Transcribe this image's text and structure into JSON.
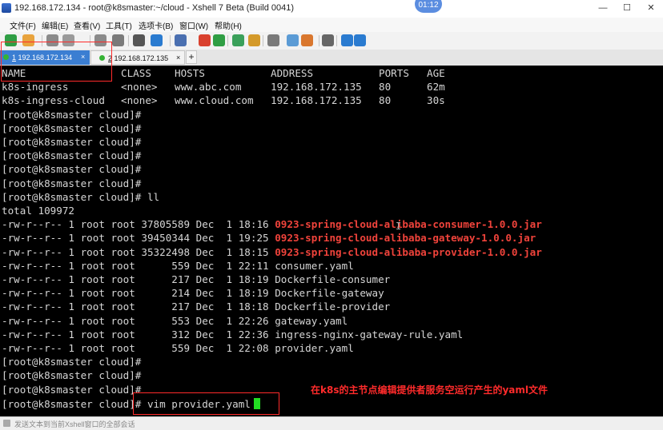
{
  "window": {
    "title": "192.168.172.134 - root@k8smaster:~/cloud - Xshell 7 Beta (Build 0041)",
    "timer": "01:12",
    "minimize": "—",
    "maximize": "☐",
    "close": "✕"
  },
  "menu": [
    "文件(F)",
    "编辑(E)",
    "查看(V)",
    "工具(T)",
    "选项卡(B)",
    "窗口(W)",
    "帮助(H)"
  ],
  "toolbar_icons": [
    {
      "name": "new-session-icon",
      "color": "#2f9e44"
    },
    {
      "name": "open-folder-icon",
      "color": "#e8a33d"
    },
    {
      "name": "link-icon",
      "color": "#8a8a8a"
    },
    {
      "name": "properties-icon",
      "color": "#9a9a9a"
    },
    {
      "name": "fullscreen-icon",
      "color": "#8a8a8a"
    },
    {
      "name": "search-icon",
      "color": "#7a7a7a"
    },
    {
      "name": "font-icon",
      "color": "#555555"
    },
    {
      "name": "globe-icon",
      "color": "#2a7bd0"
    },
    {
      "name": "script-icon",
      "color": "#4a6fb0"
    },
    {
      "name": "xftp-icon",
      "color": "#d9412e"
    },
    {
      "name": "xmanager-icon",
      "color": "#2f9e44"
    },
    {
      "name": "transfer-icon",
      "color": "#3aa05a"
    },
    {
      "name": "lock-icon",
      "color": "#d49a2a"
    },
    {
      "name": "keyboard-icon",
      "color": "#7a7a7a"
    },
    {
      "name": "compose-icon",
      "color": "#5b9bd5"
    },
    {
      "name": "camera-icon",
      "color": "#d9772e"
    },
    {
      "name": "layout-icon",
      "color": "#666666"
    },
    {
      "name": "help-icon",
      "color": "#2a7bd0"
    },
    {
      "name": "chat-icon",
      "color": "#2a7bd0"
    }
  ],
  "tabs": [
    {
      "number": "1",
      "label": "192.168.172.134",
      "close": "×"
    },
    {
      "number": "2",
      "label": "192.168.172.135",
      "close": "×"
    }
  ],
  "add_tab": "+",
  "terminal": {
    "ingress_header": [
      "NAME",
      "CLASS",
      "HOSTS",
      "ADDRESS",
      "PORTS",
      "AGE"
    ],
    "ingress_rows": [
      [
        "k8s-ingress",
        "<none>",
        "www.abc.com",
        "192.168.172.135",
        "80",
        "62m"
      ],
      [
        "k8s-ingress-cloud",
        "<none>",
        "www.cloud.com",
        "192.168.172.135",
        "80",
        "30s"
      ]
    ],
    "prompt": "[root@k8smaster cloud]#",
    "prompt_ll": "[root@k8smaster cloud]# ll",
    "total": "total 109972",
    "files": [
      {
        "meta": "-rw-r--r-- 1 root root 37805589 Dec  1 18:16 ",
        "name": "0923-spring-cloud-alibaba-consumer-1.0.0.jar",
        "jar": true
      },
      {
        "meta": "-rw-r--r-- 1 root root 39450344 Dec  1 19:25 ",
        "name": "0923-spring-cloud-alibaba-gateway-1.0.0.jar",
        "jar": true
      },
      {
        "meta": "-rw-r--r-- 1 root root 35322498 Dec  1 18:15 ",
        "name": "0923-spring-cloud-alibaba-provider-1.0.0.jar",
        "jar": true
      },
      {
        "meta": "-rw-r--r-- 1 root root      559 Dec  1 22:11 ",
        "name": "consumer.yaml",
        "jar": false
      },
      {
        "meta": "-rw-r--r-- 1 root root      217 Dec  1 18:19 ",
        "name": "Dockerfile-consumer",
        "jar": false
      },
      {
        "meta": "-rw-r--r-- 1 root root      214 Dec  1 18:19 ",
        "name": "Dockerfile-gateway",
        "jar": false
      },
      {
        "meta": "-rw-r--r-- 1 root root      217 Dec  1 18:18 ",
        "name": "Dockerfile-provider",
        "jar": false
      },
      {
        "meta": "-rw-r--r-- 1 root root      553 Dec  1 22:26 ",
        "name": "gateway.yaml",
        "jar": false
      },
      {
        "meta": "-rw-r--r-- 1 root root      312 Dec  1 22:36 ",
        "name": "ingress-nginx-gateway-rule.yaml",
        "jar": false
      },
      {
        "meta": "-rw-r--r-- 1 root root      559 Dec  1 22:08 ",
        "name": "provider.yaml",
        "jar": false
      }
    ],
    "current_command": "[root@k8smaster cloud]# vim provider.yaml"
  },
  "annotation": "在k8s的主节点编辑提供者服务空运行产生的yaml文件",
  "status_bar": "发送文本到当前Xshell窗口的全部会话",
  "colors": {
    "jar_red": "#f0433b",
    "cursor_green": "#22dd22",
    "annotation_red": "#ff2b2b",
    "tab_active": "#3b7ed2"
  }
}
